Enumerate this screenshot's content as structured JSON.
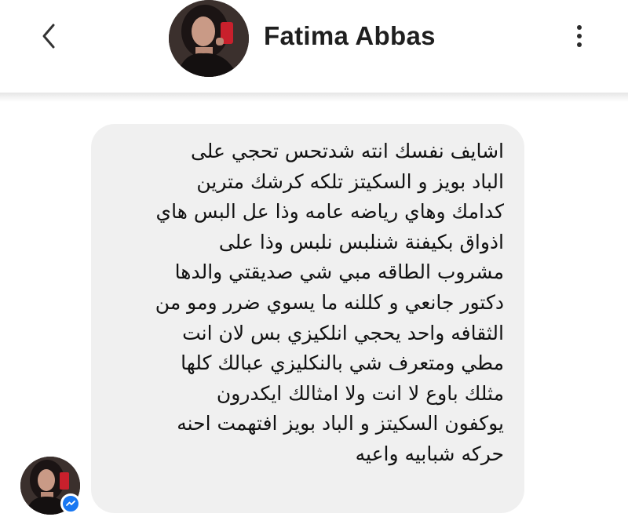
{
  "header": {
    "back_icon": "chevron-left-icon",
    "contact_name": "Fatima Abbas",
    "more_icon": "vertical-ellipsis-icon"
  },
  "message": {
    "lines": [
      "اشايف نفسك انته شدتحس تحجي على",
      "الباد بويز و السكيتز تلكه كرشك مترين",
      "كدامك وهاي رياضه عامه وذا عل البس هاي",
      "اذواق بكيفنة شنلبس نلبس وذا على",
      "مشروب الطاقه مبي شي صديقتي والدها",
      "دكتور جانعي و كللنه ما يسوي ضرر ومو من",
      "الثقافه واحد يحجي انلكيزي بس لان انت",
      "مطي ومتعرف شي بالنكليزي عبالك كلها",
      "مثلك باوع لا انت ولا امثالك ايكدرون",
      "يوكفون السكيتز و الباد بويز افتهمت احنه",
      "حركه شبابيه واعيه"
    ]
  },
  "sender": {
    "badge_icon": "messenger-icon"
  },
  "colors": {
    "bubble_bg": "#f0f0f0",
    "messenger_blue": "#1877f2",
    "text": "#111111"
  }
}
